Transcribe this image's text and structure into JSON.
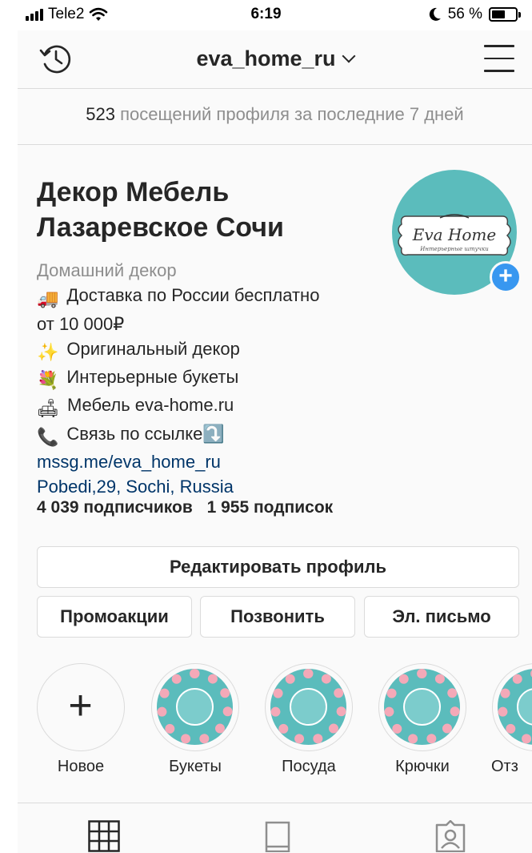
{
  "status_bar": {
    "carrier": "Tele2",
    "time": "6:19",
    "battery_text": "56 %",
    "battery_level": 0.56
  },
  "nav": {
    "username": "eva_home_ru",
    "history_icon": "history-icon",
    "menu_icon": "hamburger-menu-icon"
  },
  "visits": {
    "count": "523",
    "text": "посещений профиля за последние 7 дней"
  },
  "profile": {
    "name_line1": "Декор Мебель",
    "name_line2": "Лазаревское Сочи",
    "avatar_logo_text": "Eva Home",
    "avatar_logo_subtext": "Интерьерные штучки",
    "category": "Домашний декор",
    "bio_lines": [
      {
        "emoji": "🚚",
        "text": "Доставка по России бесплатно"
      },
      {
        "emoji": "",
        "text": "от 10 000₽"
      },
      {
        "emoji": "✨",
        "text": "Оригинальный декор"
      },
      {
        "emoji": "💐",
        "text": "Интерьерные букеты"
      },
      {
        "emoji": "🛋",
        "text": "Мебель eva-home.ru"
      },
      {
        "emoji": "📞",
        "text": "Связь по ссылке⤵️"
      }
    ],
    "link": "mssg.me/eva_home_ru",
    "address": "Pobedi,29, Sochi, Russia",
    "followers": "4 039 подписчиков",
    "following": "1 955 подписок"
  },
  "buttons": {
    "edit_profile": "Редактировать профиль",
    "promotions": "Промоакции",
    "call": "Позвонить",
    "email": "Эл. письмо"
  },
  "highlights": [
    {
      "label": "Новое",
      "icon": "plus-icon"
    },
    {
      "label": "Букеты",
      "icon": "flower-icon"
    },
    {
      "label": "Посуда",
      "icon": "cup-icon"
    },
    {
      "label": "Крючки",
      "icon": "hook-icon"
    },
    {
      "label": "Отз",
      "icon": "heart-icon"
    }
  ],
  "tabs": [
    {
      "icon": "grid-icon"
    },
    {
      "icon": "feed-icon"
    },
    {
      "icon": "tagged-icon"
    }
  ],
  "colors": {
    "accent_blue": "#3897f0",
    "link_blue": "#003569",
    "avatar_teal": "#5bbcbc"
  }
}
